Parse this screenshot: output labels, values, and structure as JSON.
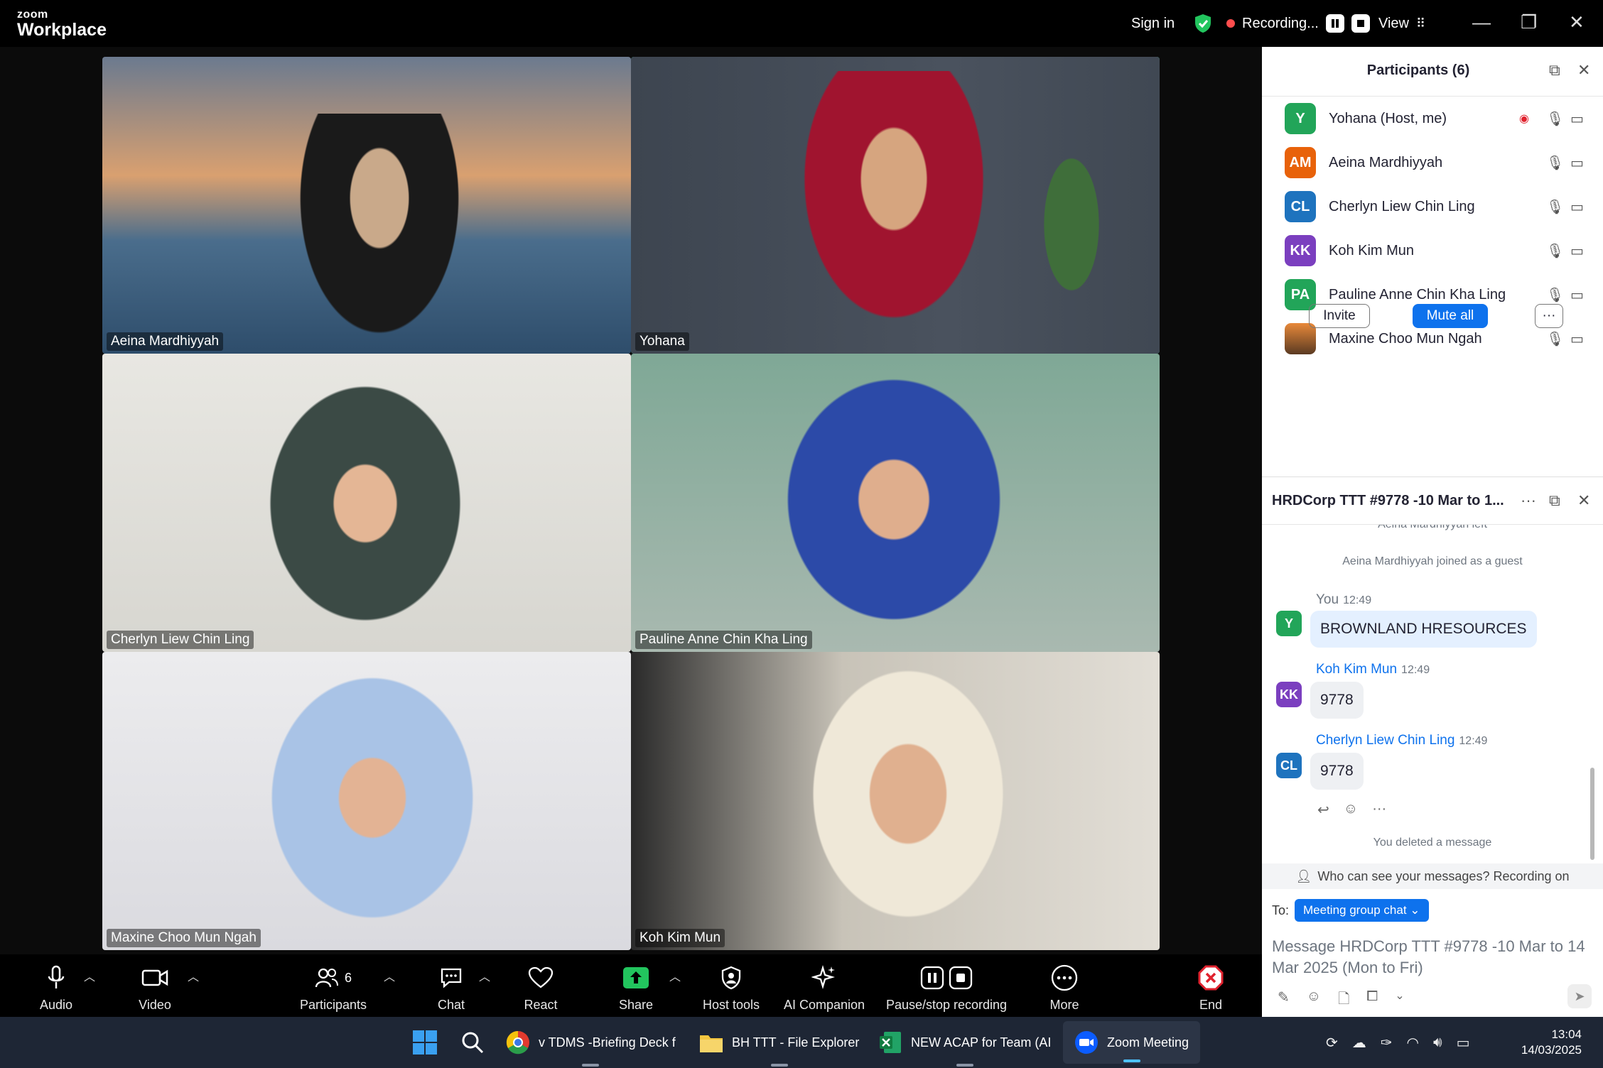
{
  "app": {
    "brand_small": "zoom",
    "brand_big": "Workplace"
  },
  "titlebar": {
    "signin": "Sign in",
    "recording": "Recording...",
    "view": "View"
  },
  "tiles": [
    {
      "name": "Aeina Mardhiyyah"
    },
    {
      "name": "Yohana"
    },
    {
      "name": "Cherlyn Liew Chin Ling"
    },
    {
      "name": "Pauline Anne Chin Kha Ling"
    },
    {
      "name": "Maxine Choo Mun Ngah"
    },
    {
      "name": "Koh Kim Mun"
    }
  ],
  "toolbar": {
    "audio": "Audio",
    "video": "Video",
    "participants": "Participants",
    "participants_count": "6",
    "chat": "Chat",
    "react": "React",
    "share": "Share",
    "host_tools": "Host tools",
    "ai_companion": "AI Companion",
    "pause_recording": "Pause/stop recording",
    "more": "More",
    "end": "End"
  },
  "participants_panel": {
    "title": "Participants (6)",
    "list": [
      {
        "initials": "Y",
        "name": "Yohana (Host, me)",
        "color": "#22a559"
      },
      {
        "initials": "AM",
        "name": "Aeina Mardhiyyah",
        "color": "#e8620a"
      },
      {
        "initials": "CL",
        "name": "Cherlyn Liew Chin Ling",
        "color": "#1e73be"
      },
      {
        "initials": "KK",
        "name": "Koh Kim Mun",
        "color": "#7b3fbf"
      },
      {
        "initials": "PA",
        "name": "Pauline Anne Chin Kha Ling",
        "color": "#22a559"
      },
      {
        "initials": "",
        "name": "Maxine Choo Mun Ngah",
        "color": "#8a5a34"
      }
    ],
    "invite": "Invite",
    "mute_all": "Mute all"
  },
  "chat_panel": {
    "title": "HRDCorp TTT #9778 -10 Mar to 1...",
    "partial_sys": "Aeina Mardhiyyah left",
    "sys_joined": "Aeina Mardhiyyah joined as a guest",
    "messages": [
      {
        "initials": "Y",
        "sender": "You",
        "time": "12:49",
        "text": "BROWNLAND HRESOURCES",
        "color": "#22a559",
        "sender_color": "#6e7680"
      },
      {
        "initials": "KK",
        "sender": "Koh Kim Mun",
        "time": "12:49",
        "text": "9778",
        "color": "#7b3fbf",
        "sender_color": "#0e72ed"
      },
      {
        "initials": "CL",
        "sender": "Cherlyn Liew Chin Ling",
        "time": "12:49",
        "text": "9778",
        "color": "#1e73be",
        "sender_color": "#0e72ed"
      }
    ],
    "deleted": "You deleted a message",
    "visibility": "Who can see your messages? Recording on",
    "to_label": "To:",
    "to_value": "Meeting group chat",
    "placeholder": "Message HRDCorp TTT #9778 -10 Mar to 14 Mar 2025  (Mon to Fri)"
  },
  "taskbar": {
    "apps": [
      {
        "label": "v TDMS -Briefing Deck f"
      },
      {
        "label": "BH TTT - File Explorer"
      },
      {
        "label": "NEW ACAP for Team (AI"
      },
      {
        "label": "Zoom Meeting"
      }
    ],
    "time": "13:04",
    "date": "14/03/2025"
  },
  "colors": {
    "accent": "#0e72ed",
    "active_speaker": "#2bd4a0",
    "share": "#22c55e",
    "end": "#e0222e"
  }
}
